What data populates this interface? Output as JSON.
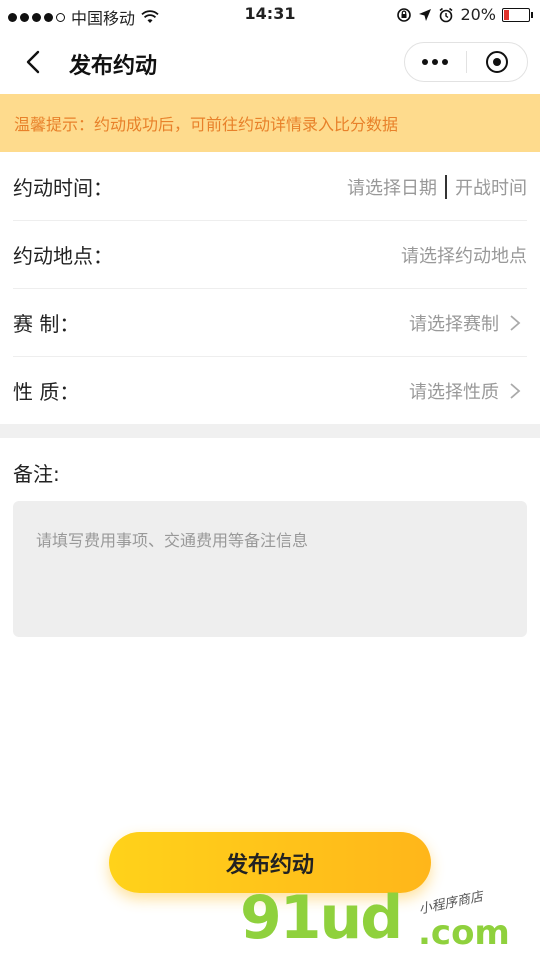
{
  "status_bar": {
    "carrier": "中国移动",
    "time": "14:31",
    "battery": "20%",
    "battery_level": 0.2
  },
  "nav": {
    "title": "发布约动"
  },
  "notice": {
    "text": "温馨提示：约动成功后，可前往约动详情录入比分数据"
  },
  "form": {
    "rows": [
      {
        "label": "约动时间：",
        "date_placeholder": "请选择日期",
        "time_placeholder": "开战时间"
      },
      {
        "label": "约动地点：",
        "value": "请选择约动地点"
      },
      {
        "label": "赛 制：",
        "value": "请选择赛制"
      },
      {
        "label": "性 质：",
        "value": "请选择性质"
      }
    ]
  },
  "notes": {
    "label": "备注:",
    "placeholder": "请填写费用事项、交通费用等备注信息"
  },
  "publish_button": {
    "label": "发布约动"
  },
  "watermark": {
    "main": "91ud",
    "domain": ".com",
    "sub": "小程序商店"
  },
  "colors": {
    "notice_bg": "#fedb8d",
    "notice_text": "#e8812a",
    "button_gradient_start": "#ffd21a",
    "button_gradient_end": "#ffb61a",
    "battery": "#e0322a",
    "watermark": "#8fd13d"
  },
  "icons": {
    "signal": "signal-dots-icon",
    "wifi": "wifi-icon",
    "lock": "rotation-lock-icon",
    "location": "location-arrow-icon",
    "alarm": "alarm-icon",
    "battery": "battery-icon",
    "back": "back-arrow-icon",
    "more": "more-dots-icon",
    "close": "target-circle-icon",
    "chevron": "chevron-right-icon"
  }
}
